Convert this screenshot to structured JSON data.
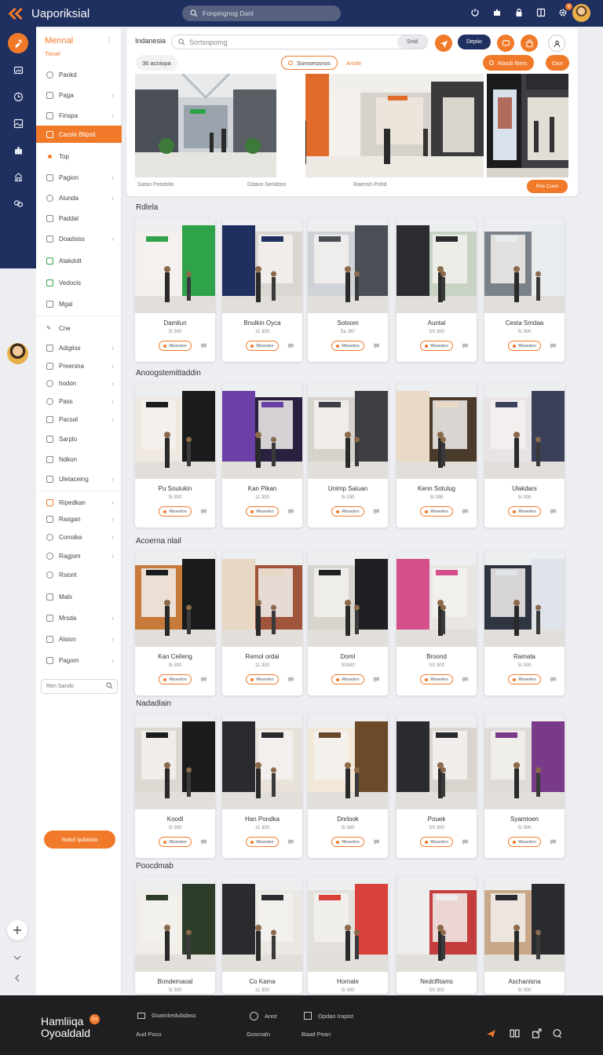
{
  "app": {
    "title": "Uaporiksial",
    "search_placeholder": "Fonpingnog Danl"
  },
  "sidebar": {
    "title": "Mennal",
    "subtitle": "Tiesel",
    "items": [
      "Paokd",
      "Paga",
      "Finspa",
      "Carsie Blipsit",
      "Top",
      "Pagion",
      "Aiunda",
      "Paddal",
      "Doadsiss",
      "Atakdolt",
      "Vedocis",
      "Mgal",
      "Cne",
      "Adigiiss",
      "Preenina",
      "hodon",
      "Pass",
      "Pacsal",
      "Sarplo",
      "Ndkon",
      "Uletaceing",
      "Ripedkan",
      "Rasgan",
      "Conoika",
      "Ragjom",
      "Rsiont",
      "Mals",
      "Mrsda",
      "Alsion",
      "Pagom"
    ],
    "search_placeholder": "Ren Sando",
    "cta": "Ratol Ipdaiolo"
  },
  "hero": {
    "location": "Indanesia",
    "search_placeholder": "Sortsnpomg",
    "search_tail": "Snid",
    "blue_pill": "Depiio",
    "chip_left": "36 acoiopa",
    "chip_active": "Somsessnos",
    "chip_right": "Ansfe",
    "chip_orange": "Rasdi fiters",
    "chip_small": "Osn",
    "foot": [
      "Satsn Potolstin",
      "Ddavo Senkbsn",
      "Raensh Pohd"
    ],
    "cta": "Prie Cuen"
  },
  "sections": [
    {
      "title": "Rdlela",
      "cards": [
        {
          "name": "Damliun",
          "sub": "Si 300"
        },
        {
          "name": "Bnulkin Oyca",
          "sub": "11 300"
        },
        {
          "name": "Sotoom",
          "sub": "Sa 287"
        },
        {
          "name": "Auntal",
          "sub": "SS 300"
        },
        {
          "name": "Cesta Smdaa",
          "sub": "Si 300"
        }
      ]
    },
    {
      "title": "Anoogstemittaddin",
      "cards": [
        {
          "name": "Pu Soulukin",
          "sub": "Si 300"
        },
        {
          "name": "Kan Pikan",
          "sub": "11 300"
        },
        {
          "name": "Unimp Saiuan",
          "sub": "Si 330"
        },
        {
          "name": "Kenn Sotulug",
          "sub": "Si 288"
        },
        {
          "name": "Ulakdars",
          "sub": "Si 300"
        }
      ]
    },
    {
      "title": "Acoerna nlail",
      "cards": [
        {
          "name": "Kan Ceileng",
          "sub": "Si 300"
        },
        {
          "name": "Remol ordai",
          "sub": "11 300"
        },
        {
          "name": "Doml",
          "sub": "S0300"
        },
        {
          "name": "Broond",
          "sub": "SS 300"
        },
        {
          "name": "Ramata",
          "sub": "Si 300"
        }
      ]
    },
    {
      "title": "Nadadlain",
      "cards": [
        {
          "name": "Koodl",
          "sub": "Si 300"
        },
        {
          "name": "Han Pondka",
          "sub": "11 300"
        },
        {
          "name": "Dnrlook",
          "sub": "Si 300"
        },
        {
          "name": "Pouek",
          "sub": "SS 300"
        },
        {
          "name": "Syamtoen",
          "sub": "Si 300"
        }
      ]
    },
    {
      "title": "Poocdmab",
      "cards": [
        {
          "name": "Bondemaoal",
          "sub": "Si 300"
        },
        {
          "name": "Co Kama",
          "sub": "11 300"
        },
        {
          "name": "Hornale",
          "sub": "Si 300"
        },
        {
          "name": "Nedclfitams",
          "sub": "SS 300"
        },
        {
          "name": "Aschanisna",
          "sub": "Si 300"
        }
      ]
    }
  ],
  "card_pill": "Rboedon",
  "footer": {
    "brand_line1": "Hamliiqa",
    "brand_line2": "Oyoaldald",
    "links": [
      "Goatnkedubdass",
      "Aud Poco",
      "Anot",
      "Gosmaln",
      "Opdan Irapist",
      "Baad Pean"
    ]
  },
  "colors": {
    "accent": "#f07a2a",
    "navy": "#1f2f5f",
    "footer": "#1f1f22"
  }
}
